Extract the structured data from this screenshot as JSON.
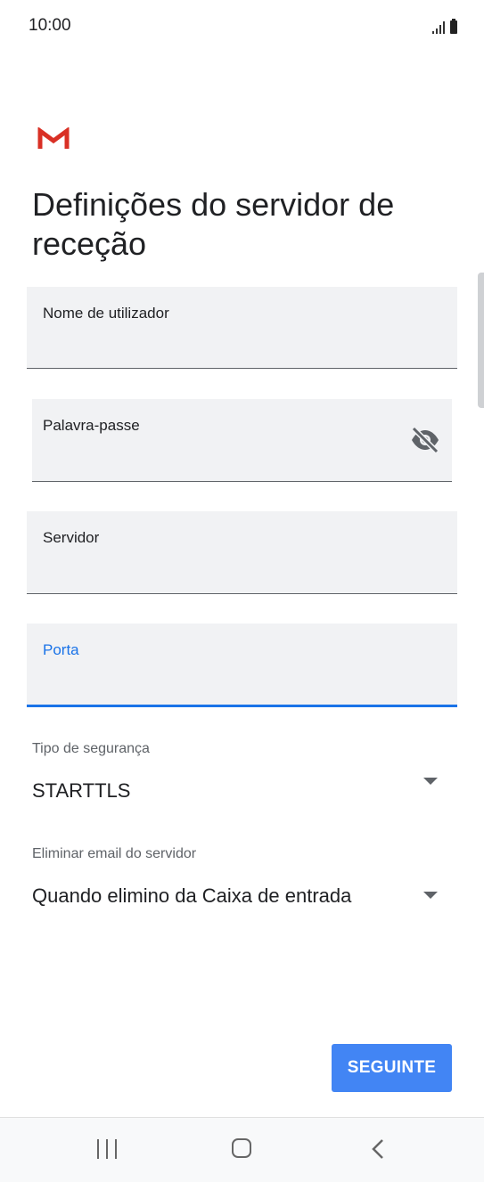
{
  "status_bar": {
    "time": "10:00",
    "icons": [
      "signal-icon",
      "battery-icon"
    ]
  },
  "app": {
    "logo": "gmail-logo",
    "brand_red": "#d93025"
  },
  "page": {
    "title": "Definições do servidor de receção"
  },
  "form": {
    "username": {
      "label": "Nome de utilizador",
      "value": ""
    },
    "password": {
      "label": "Palavra-passe",
      "value": "",
      "toggle_icon": "eye-off-icon"
    },
    "server": {
      "label": "Servidor",
      "value": ""
    },
    "port": {
      "label": "Porta",
      "value": "",
      "focused": true
    }
  },
  "security": {
    "label": "Tipo de segurança",
    "value": "STARTTLS"
  },
  "delete_email": {
    "label": "Eliminar email do servidor",
    "value": "Quando elimino da Caixa de entrada"
  },
  "actions": {
    "next_label": "SEGUINTE"
  },
  "nav_bar": {
    "icons": [
      "recent-apps-icon",
      "home-icon",
      "back-icon"
    ]
  },
  "colors": {
    "accent": "#1a73e8",
    "button": "#4285f4",
    "field_background": "#f1f2f4"
  }
}
